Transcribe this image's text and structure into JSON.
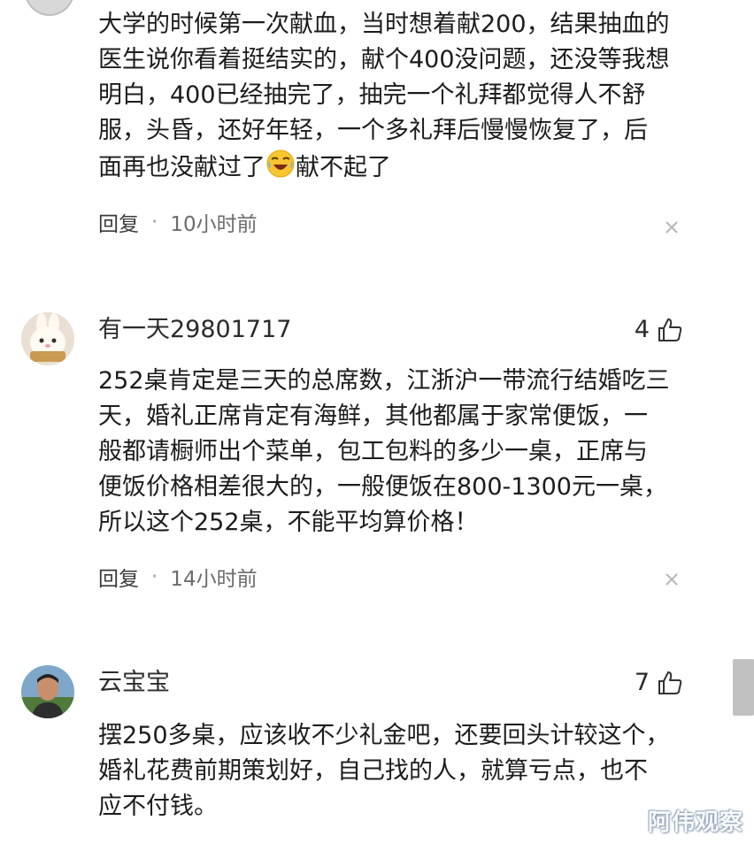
{
  "comments": [
    {
      "body_before_emoji": "大学的时候第一次献血，当时想着献200，结果抽血的\n医生说你看着挺结实的，献个400没问题，还没等我想\n明白，400已经抽完了，抽完一个礼拜都觉得人不舒\n服，头昏，还好年轻，一个多礼拜后慢慢恢复了，后\n面再也没献过了",
      "body_after_emoji": "献不起了",
      "emoji": "laugh-cry-emoji",
      "reply_label": "回复",
      "separator": "·",
      "time": "10小时前"
    },
    {
      "username": "有一天29801717",
      "likes": "4",
      "avatar": "rabbit-avatar",
      "body": "252桌肯定是三天的总席数，江浙沪一带流行结婚吃三\n天，婚礼正席肯定有海鲜，其他都属于家常便饭，一\n般都请橱师出个菜单，包工包料的多少一桌，正席与\n便饭价格相差很大的，一般便饭在800-1300元一桌，\n所以这个252桌，不能平均算价格！",
      "reply_label": "回复",
      "separator": "·",
      "time": "14小时前"
    },
    {
      "username": "云宝宝",
      "likes": "7",
      "avatar": "man-avatar",
      "body": "摆250多桌，应该收不少礼金吧，还要回头计较这个，\n婚礼花费前期策划好，自己找的人，就算亏点，也不\n应不付钱。"
    }
  ],
  "watermark": "阿伟观察",
  "colors": {
    "text": "#1c1c1c",
    "meta": "#6c6c6c",
    "scrollbar": "#c1c1c1"
  }
}
